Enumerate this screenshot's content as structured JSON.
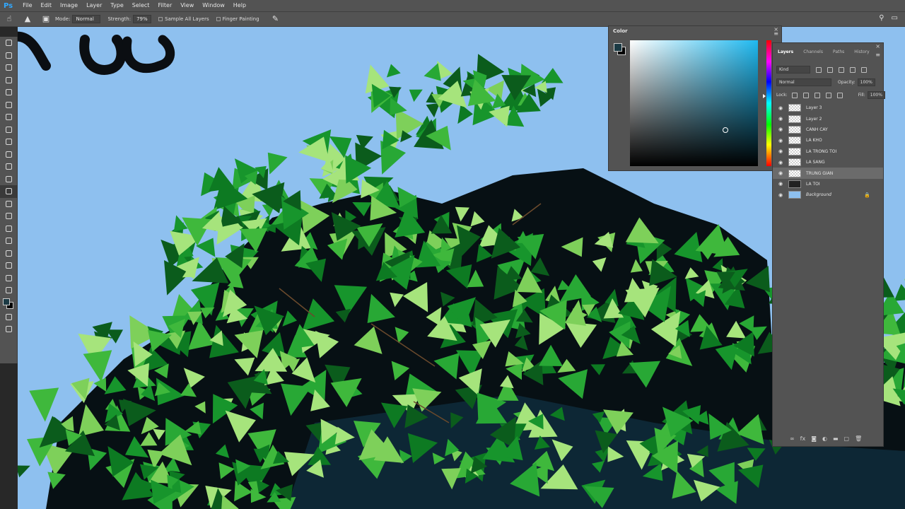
{
  "app": {
    "logo": "Ps"
  },
  "menu": [
    "File",
    "Edit",
    "Image",
    "Layer",
    "Type",
    "Select",
    "Filter",
    "View",
    "Window",
    "Help"
  ],
  "options": {
    "mode_label": "Mode:",
    "mode_value": "Normal",
    "strength_label": "Strength:",
    "strength_value": "79%",
    "sample_all_layers": "Sample All Layers",
    "finger_painting": "Finger Painting"
  },
  "color_panel": {
    "title": "Color",
    "foreground": "#1b3a44",
    "background": "#000000",
    "hue": "#1fb9f0"
  },
  "layers_panel": {
    "tabs": [
      "Layers",
      "Channels",
      "Paths",
      "History"
    ],
    "filter_kind": "Kind",
    "blend_mode": "Normal",
    "opacity_label": "Opacity:",
    "opacity_value": "100%",
    "lock_label": "Lock:",
    "fill_label": "Fill:",
    "fill_value": "100%",
    "layers": [
      {
        "name": "Layer 3",
        "thumb": "transparent",
        "selected": false
      },
      {
        "name": "Layer 2",
        "thumb": "transparent",
        "selected": false
      },
      {
        "name": "CANH CAY",
        "thumb": "transparent",
        "selected": false
      },
      {
        "name": "LA KHO",
        "thumb": "transparent",
        "selected": false
      },
      {
        "name": "LA TRONG TOI",
        "thumb": "transparent",
        "selected": false
      },
      {
        "name": "LA SANG",
        "thumb": "transparent",
        "selected": false
      },
      {
        "name": "TRUNG GIAN",
        "thumb": "transparent",
        "selected": true
      },
      {
        "name": "LA TOI",
        "thumb": "dark",
        "selected": false
      },
      {
        "name": "Background",
        "thumb": "sky",
        "selected": false,
        "locked": true
      }
    ]
  },
  "colors": {
    "sky": "#8ec0ef",
    "ui_panel": "#535353",
    "leaf_bright": "#a2e67a",
    "leaf_mid": "#33b034",
    "leaf_dark": "#118a2a"
  }
}
